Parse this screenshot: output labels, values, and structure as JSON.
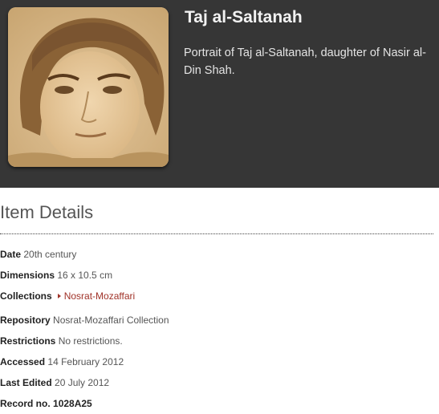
{
  "item": {
    "title": "Taj al-Saltanah",
    "description": "Portrait of Taj al-Saltanah, daughter of Nasir al-Din Shah."
  },
  "details": {
    "heading": "Item Details",
    "date": {
      "label": "Date",
      "value": "20th century"
    },
    "dimensions": {
      "label": "Dimensions",
      "value": "16 x 10.5 cm"
    },
    "collections": {
      "label": "Collections",
      "value": "Nosrat-Mozaffari"
    },
    "repository": {
      "label": "Repository",
      "value": "Nosrat-Mozaffari Collection"
    },
    "restrictions": {
      "label": "Restrictions",
      "value": "No restrictions."
    },
    "accessed": {
      "label": "Accessed",
      "value": "14 February 2012"
    },
    "last_edited": {
      "label": "Last Edited",
      "value": "20 July 2012"
    },
    "record": {
      "label": "Record no.",
      "value": "1028A25"
    }
  },
  "colors": {
    "header_bg": "#363636",
    "link": "#a03228",
    "photo_sepia": "#d8b888"
  }
}
